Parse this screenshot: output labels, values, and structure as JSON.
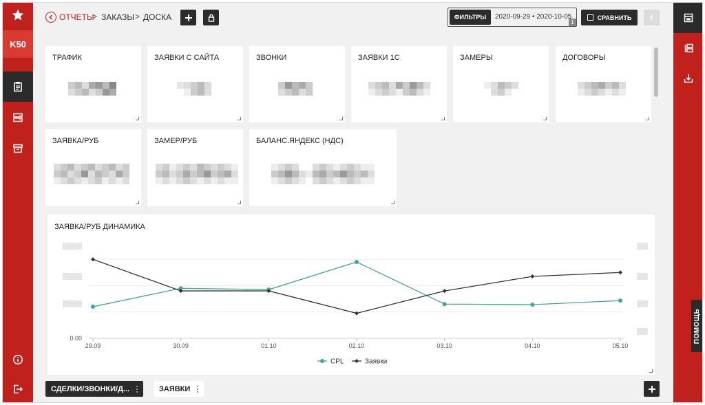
{
  "brand": {
    "label": "K50"
  },
  "breadcrumb": {
    "back": "Отчеты",
    "sep1": ">",
    "orders": "Заказы",
    "sep2": ">",
    "board": "Доска"
  },
  "toolbar": {
    "filters_label": "ФИЛЬТРЫ",
    "date_range": "2020-09-29 • 2020-10-05",
    "filters_count": "1",
    "compare_label": "СРАВНИТЬ",
    "alert_label": "!"
  },
  "cards": [
    {
      "title": "ТРАФИК"
    },
    {
      "title": "ЗАЯВКИ С САЙТА"
    },
    {
      "title": "ЗВОНКИ"
    },
    {
      "title": "ЗАЯВКИ 1С"
    },
    {
      "title": "ЗАМЕРЫ"
    },
    {
      "title": "ДОГОВОРЫ"
    },
    {
      "title": "ЗАЯВКА/РУБ"
    },
    {
      "title": "ЗАМЕР/РУБ"
    },
    {
      "title": "БАЛАНС.ЯНДЕКС (НДС)"
    }
  ],
  "help_label": "ПОМОЩЬ",
  "tabs": [
    {
      "label": "СДЕЛКИ/ЗВОНКИ/Д..."
    },
    {
      "label": "ЗАЯВКИ"
    }
  ],
  "icons": {
    "star": "star-icon",
    "nav": [
      "clipboard-icon",
      "server-icon",
      "archive-icon",
      "info-icon",
      "logout-icon"
    ],
    "right": [
      "dashboard-icon",
      "layers-icon",
      "download-icon"
    ],
    "top": [
      "back-icon",
      "plus-icon",
      "lock-icon",
      "compare-icon"
    ]
  },
  "colors": {
    "accent": "#c0211d",
    "dark": "#2b2b2b",
    "cpl": "#3aa89a",
    "requests": "#333333"
  },
  "chart_data": {
    "type": "line",
    "title": "ЗАЯВКА/РУБ ДИНАМИКА",
    "categories": [
      "29.09",
      "30.09",
      "01.10",
      "02.10",
      "03.10",
      "04.10",
      "05.10"
    ],
    "y_tick_label": "0.00",
    "grid": true,
    "legend_position": "bottom-center",
    "series": [
      {
        "name": "CPL",
        "color": "#3aa89a",
        "marker": "circle",
        "axis": "left",
        "values": [
          1.2,
          1.9,
          1.85,
          2.9,
          1.3,
          1.28,
          1.43
        ]
      },
      {
        "name": "Заявки",
        "color": "#333333",
        "marker": "diamond",
        "axis": "right",
        "values": [
          3.0,
          1.8,
          1.8,
          0.95,
          1.8,
          2.35,
          2.5
        ]
      }
    ],
    "y_left_range": [
      0,
      3.5
    ],
    "y_right_range": [
      0,
      3.5
    ]
  }
}
